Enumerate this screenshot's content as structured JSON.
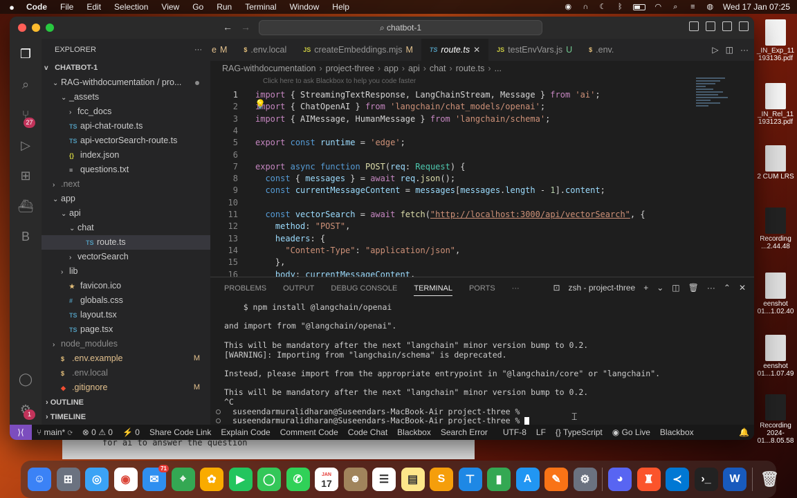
{
  "menubar": {
    "items": [
      "Code",
      "File",
      "Edit",
      "Selection",
      "View",
      "Go",
      "Run",
      "Terminal",
      "Window",
      "Help"
    ],
    "clock": "Wed 17 Jan  07:25"
  },
  "window": {
    "command_center": "chatbot-1"
  },
  "activity": {
    "scm_badge": "27",
    "settings_badge": "1"
  },
  "explorer": {
    "title": "EXPLORER",
    "root": "CHATBOT-1",
    "items": [
      {
        "label": "RAG-withdocumentation / pro...",
        "indent": 1,
        "chev": "v",
        "icon": "",
        "cls": "dot"
      },
      {
        "label": "_assets",
        "indent": 2,
        "chev": "v",
        "icon": ""
      },
      {
        "label": "fcc_docs",
        "indent": 3,
        "chev": ">",
        "icon": ""
      },
      {
        "label": "api-chat-route.ts",
        "indent": 2,
        "chev": "",
        "icon": "TS"
      },
      {
        "label": "api-vectorSearch-route.ts",
        "indent": 2,
        "chev": "",
        "icon": "TS"
      },
      {
        "label": "index.json",
        "indent": 2,
        "chev": "",
        "icon": "{}"
      },
      {
        "label": "questions.txt",
        "indent": 2,
        "chev": "",
        "icon": "≡"
      },
      {
        "label": ".next",
        "indent": 1,
        "chev": ">",
        "icon": "",
        "cls": "dim"
      },
      {
        "label": "app",
        "indent": 1,
        "chev": "v",
        "icon": ""
      },
      {
        "label": "api",
        "indent": 2,
        "chev": "v",
        "icon": ""
      },
      {
        "label": "chat",
        "indent": 3,
        "chev": "v",
        "icon": ""
      },
      {
        "label": "route.ts",
        "indent": 4,
        "chev": "",
        "icon": "TS",
        "cls": "selected"
      },
      {
        "label": "vectorSearch",
        "indent": 3,
        "chev": ">",
        "icon": ""
      },
      {
        "label": "lib",
        "indent": 2,
        "chev": ">",
        "icon": ""
      },
      {
        "label": "favicon.ico",
        "indent": 2,
        "chev": "",
        "icon": "★"
      },
      {
        "label": "globals.css",
        "indent": 2,
        "chev": "",
        "icon": "#"
      },
      {
        "label": "layout.tsx",
        "indent": 2,
        "chev": "",
        "icon": "TS"
      },
      {
        "label": "page.tsx",
        "indent": 2,
        "chev": "",
        "icon": "TS"
      },
      {
        "label": "node_modules",
        "indent": 1,
        "chev": ">",
        "icon": "",
        "cls": "dim"
      },
      {
        "label": ".env.example",
        "indent": 1,
        "chev": "",
        "icon": "$",
        "cls": "modified",
        "mark": "M"
      },
      {
        "label": ".env.local",
        "indent": 1,
        "chev": "",
        "icon": "$",
        "cls": "dim"
      },
      {
        "label": ".gitignore",
        "indent": 1,
        "chev": "",
        "icon": "◆",
        "cls": "modified",
        "mark": "M"
      }
    ],
    "outline": "OUTLINE",
    "timeline": "TIMELINE"
  },
  "tabs": [
    {
      "label": "e",
      "icon": "",
      "mark": "M"
    },
    {
      "label": ".env.local",
      "icon": "$",
      "mark": ""
    },
    {
      "label": "createEmbeddings.mjs",
      "icon": "JS",
      "mark": "M"
    },
    {
      "label": "route.ts",
      "icon": "TS",
      "mark": "",
      "active": true
    },
    {
      "label": "testEnvVars.js",
      "icon": "JS",
      "mark": "U"
    },
    {
      "label": ".env.",
      "icon": "$",
      "mark": ""
    }
  ],
  "breadcrumb": [
    "RAG-withdocumentation",
    "project-three",
    "app",
    "api",
    "chat",
    "route.ts",
    "..."
  ],
  "editor": {
    "hint": "Click here to ask Blackbox to help you code faster",
    "line_numbers": [
      "1",
      "2",
      "3",
      "4",
      "5",
      "6",
      "7",
      "8",
      "9",
      "10",
      "11",
      "12",
      "13",
      "14",
      "15",
      "16"
    ]
  },
  "panel": {
    "tabs": [
      "PROBLEMS",
      "OUTPUT",
      "DEBUG CONSOLE",
      "TERMINAL",
      "PORTS",
      "···"
    ],
    "terminal_name": "zsh - project-three",
    "lines": [
      "    $ npm install @langchain/openai",
      "",
      "and import from \"@langchain/openai\".",
      "",
      "This will be mandatory after the next \"langchain\" minor version bump to 0.2.",
      "[WARNING]: Importing from \"langchain/schema\" is deprecated.",
      "",
      "Instead, please import from the appropriate entrypoint in \"@langchain/core\" or \"langchain\".",
      "",
      "This will be mandatory after the next \"langchain\" minor version bump to 0.2.",
      "^C",
      "suseendarmuralidharan@Suseendars-MacBook-Air project-three %",
      "suseendarmuralidharan@Suseendars-MacBook-Air project-three %"
    ]
  },
  "statusbar": {
    "branch": "main*",
    "errors": "0",
    "warnings": "0",
    "ports": "0",
    "items": [
      "Share Code Link",
      "Explain Code",
      "Comment Code",
      "Code Chat",
      "Blackbox",
      "Search Error"
    ],
    "encoding": "UTF-8",
    "eol": "LF",
    "language": "TypeScript",
    "golive": "Go Live",
    "blackbox": "Blackbox"
  },
  "desktop": {
    "files": [
      {
        "line1": "_IN_Exp_11",
        "line2": "193136.pdf"
      },
      {
        "line1": "_IN_Rel_11",
        "line2": "193123.pdf"
      },
      {
        "line1": "2 CUM LRS",
        "line2": ""
      },
      {
        "line1": "Recording",
        "line2": "...2.44.48"
      },
      {
        "line1": "eenshot",
        "line2": "01...1.02.40"
      },
      {
        "line1": "eenshot",
        "line2": "01...1.07.49"
      },
      {
        "line1": "Recording",
        "line2": "2024-01...8.05.58"
      }
    ]
  },
  "background_window": {
    "text": "for ai to answer the question"
  },
  "dock": {
    "calendar_month": "JAN",
    "calendar_day": "17",
    "mail_badge": "71"
  }
}
